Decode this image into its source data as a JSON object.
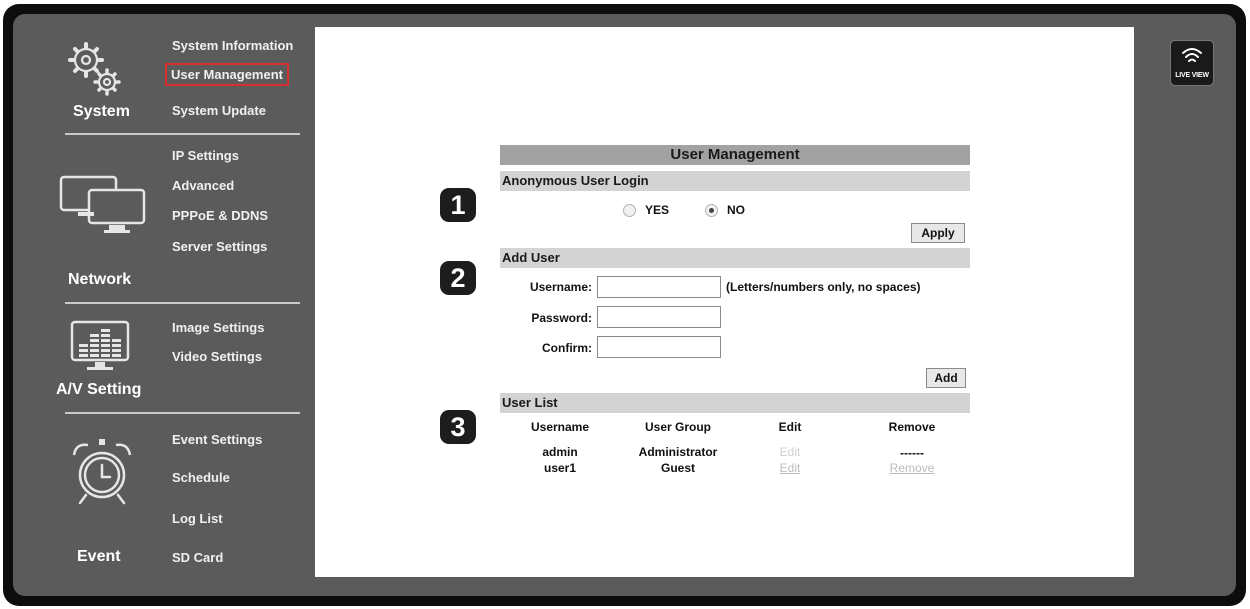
{
  "sidebar": {
    "system": {
      "title": "System",
      "icon": "gears-icon",
      "items": [
        "System Information",
        "User Management",
        "System Update"
      ]
    },
    "network": {
      "title": "Network",
      "icon": "monitors-icon",
      "items": [
        "IP Settings",
        "Advanced",
        "PPPoE & DDNS",
        "Server Settings"
      ]
    },
    "av": {
      "title": "A/V Setting",
      "icon": "equalizer-monitor-icon",
      "items": [
        "Image Settings",
        "Video Settings"
      ]
    },
    "event": {
      "title": "Event",
      "icon": "alarm-clock-icon",
      "items": [
        "Event Settings",
        "Schedule",
        "Log List",
        "SD Card"
      ]
    },
    "active_item": "User Management"
  },
  "live_view": {
    "label": "LIVE VIEW",
    "icon": "wifi-signal-icon"
  },
  "steps": [
    "1",
    "2",
    "3"
  ],
  "user_management": {
    "title": "User Management",
    "anonymous": {
      "header": "Anonymous User Login",
      "options": [
        "YES",
        "NO"
      ],
      "selected": "NO",
      "apply_label": "Apply"
    },
    "add_user": {
      "header": "Add User",
      "username_label": "Username:",
      "username_hint": "(Letters/numbers only, no spaces)",
      "password_label": "Password:",
      "confirm_label": "Confirm:",
      "add_label": "Add"
    },
    "user_list": {
      "header": "User List",
      "columns": [
        "Username",
        "User Group",
        "Edit",
        "Remove"
      ],
      "rows": [
        [
          "admin",
          "Administrator",
          "Edit",
          "------"
        ],
        [
          "user1",
          "Guest",
          "Edit",
          "Remove"
        ]
      ]
    }
  },
  "colors": {
    "panel": "#5b5b5b",
    "frame": "#0d0d0d",
    "header_dark": "#a2a2a2",
    "header_light": "#d3d3d3",
    "active_outline": "#d83030"
  }
}
